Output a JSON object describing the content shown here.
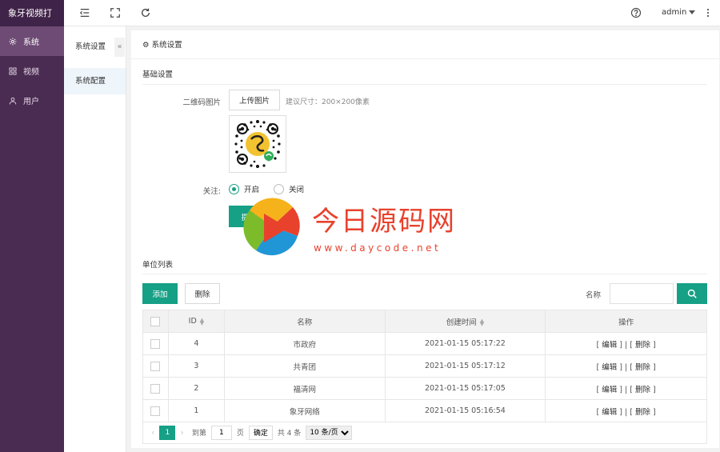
{
  "app": {
    "brand": "象牙视频打"
  },
  "sidebar": {
    "items": [
      {
        "label": "系统",
        "icon": "gear-icon",
        "active": true
      },
      {
        "label": "视频",
        "icon": "grid-icon",
        "active": false
      },
      {
        "label": "用户",
        "icon": "user-icon",
        "active": false
      }
    ]
  },
  "topbar": {
    "user": "admin"
  },
  "submenu": {
    "title": "系统设置",
    "items": [
      "系统配置"
    ]
  },
  "panel": {
    "header": "系统设置",
    "basic": {
      "title": "基础设置",
      "qr_label": "二维码图片",
      "upload_label": "上传图片",
      "upload_hint": "建议尺寸：200×200像素",
      "follow_label": "关注:",
      "follow_on": "开启",
      "follow_off": "关闭",
      "submit_label": "提交"
    },
    "units": {
      "title": "单位列表",
      "add_label": "添加",
      "delete_label": "删除",
      "search_label": "名称",
      "search_value": "",
      "columns": {
        "id": "ID",
        "name": "名称",
        "created": "创建时间",
        "ops": "操作"
      },
      "rows": [
        {
          "id": "4",
          "name": "市政府",
          "created": "2021-01-15 05:17:22"
        },
        {
          "id": "3",
          "name": "共青团",
          "created": "2021-01-15 05:17:12"
        },
        {
          "id": "2",
          "name": "福清网",
          "created": "2021-01-15 05:17:05"
        },
        {
          "id": "1",
          "name": "象牙网络",
          "created": "2021-01-15 05:16:54"
        }
      ],
      "op_edit": "编辑",
      "op_delete": "删除"
    },
    "pager": {
      "current": "1",
      "goto_label": "到第",
      "page_value": "1",
      "page_unit": "页",
      "confirm": "确定",
      "total": "共 4 条",
      "per_page": "10 条/页"
    }
  },
  "watermark": {
    "title": "今日源码网",
    "url": "www.daycode.net"
  },
  "colors": {
    "sidebar": "#4a2b52",
    "accent": "#16a085",
    "watermark": "#e8422d"
  }
}
